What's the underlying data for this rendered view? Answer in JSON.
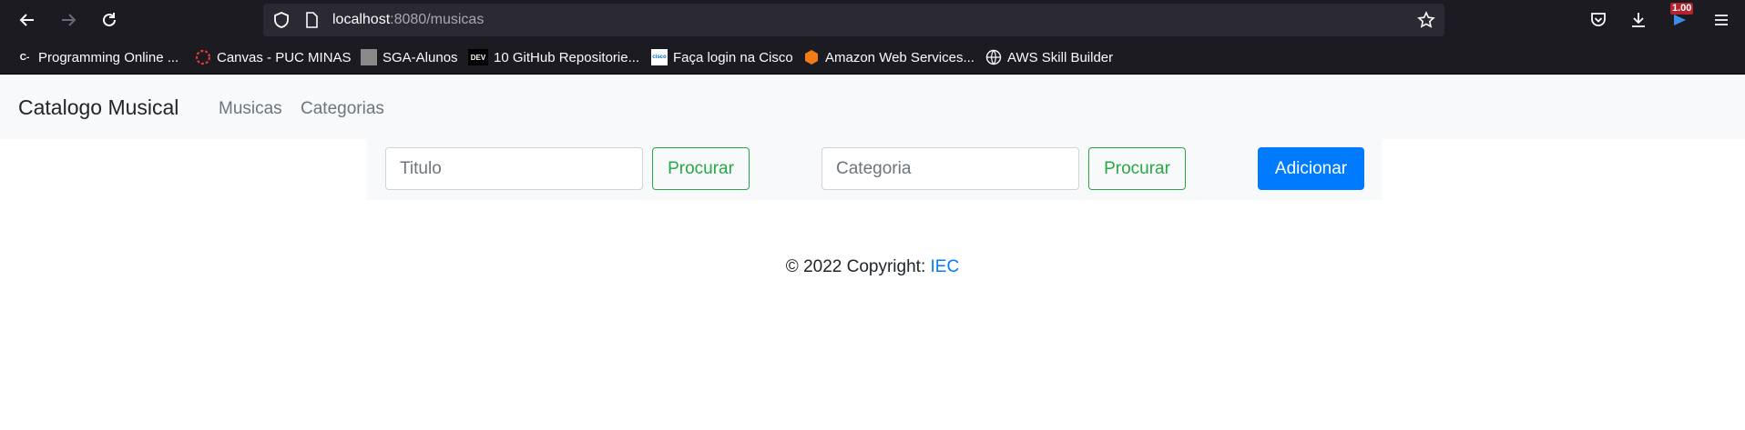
{
  "browser": {
    "url_host": "localhost",
    "url_path": ":8080/musicas",
    "extension_badge": "1.00",
    "bookmarks": [
      {
        "label": "Programming Online ...",
        "icon": "c-dash-icon"
      },
      {
        "label": "Canvas - PUC MINAS",
        "icon": "canvas-icon"
      },
      {
        "label": "SGA-Alunos",
        "icon": "sga-icon"
      },
      {
        "label": "10 GitHub Repositorie...",
        "icon": "dev-icon"
      },
      {
        "label": "Faça login na Cisco",
        "icon": "cisco-icon"
      },
      {
        "label": "Amazon Web Services...",
        "icon": "aws-icon"
      },
      {
        "label": "AWS Skill Builder",
        "icon": "globe-icon"
      }
    ]
  },
  "navbar": {
    "brand": "Catalogo Musical",
    "links": [
      "Musicas",
      "Categorias"
    ]
  },
  "search": {
    "title_placeholder": "Titulo",
    "title_button": "Procurar",
    "category_placeholder": "Categoria",
    "category_button": "Procurar",
    "add_button": "Adicionar"
  },
  "footer": {
    "text": "© 2022 Copyright: ",
    "link": "IEC"
  },
  "colors": {
    "primary": "#007bff",
    "success": "#28a745",
    "navbar_bg": "#f8f9fa",
    "chrome_bg": "#1c1b22"
  }
}
